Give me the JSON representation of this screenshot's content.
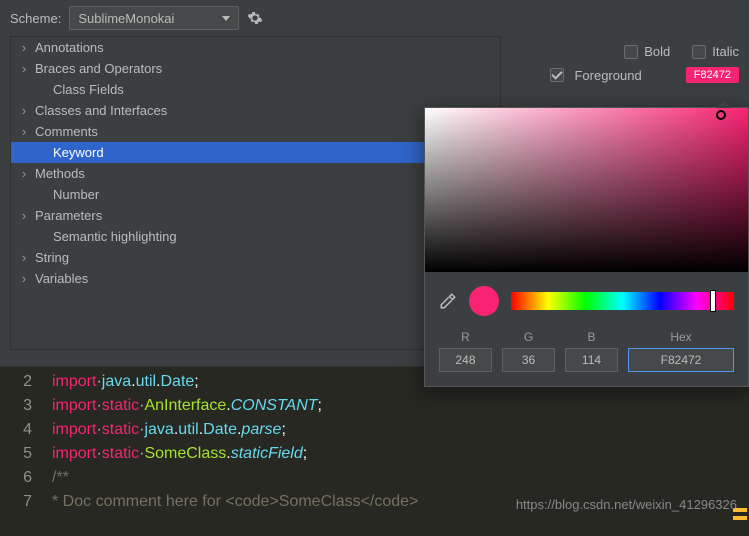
{
  "scheme": {
    "label": "Scheme:",
    "value": "SublimeMonokai"
  },
  "attributes": [
    {
      "label": "Annotations",
      "exp": true
    },
    {
      "label": "Braces and Operators",
      "exp": true
    },
    {
      "label": "Class Fields",
      "exp": false,
      "indent": true
    },
    {
      "label": "Classes and Interfaces",
      "exp": true
    },
    {
      "label": "Comments",
      "exp": true
    },
    {
      "label": "Keyword",
      "exp": false,
      "indent": true,
      "selected": true
    },
    {
      "label": "Methods",
      "exp": true
    },
    {
      "label": "Number",
      "exp": false,
      "indent": true
    },
    {
      "label": "Parameters",
      "exp": true
    },
    {
      "label": "Semantic highlighting",
      "exp": false,
      "indent": true
    },
    {
      "label": "String",
      "exp": true
    },
    {
      "label": "Variables",
      "exp": true
    }
  ],
  "fontOptions": {
    "bold": "Bold",
    "italic": "Italic",
    "foreground": "Foreground"
  },
  "swatch": "F82472",
  "picker": {
    "r": "R",
    "g": "G",
    "b": "B",
    "hex": "Hex",
    "rVal": "248",
    "gVal": "36",
    "bVal": "114",
    "hexVal": "F82472"
  },
  "code": {
    "l2a": "import",
    "l2b": "java",
    "l2c": "util",
    "l2d": "Date",
    "l3a": "import",
    "l3b": "static",
    "l3c": "AnInterface",
    "l3d": "CONSTANT",
    "l4a": "import",
    "l4b": "static",
    "l4c": "java",
    "l4d": "util",
    "l4e": "Date",
    "l4f": "parse",
    "l5a": "import",
    "l5b": "static",
    "l5c": "SomeClass",
    "l5d": "staticField",
    "l6": "/**",
    "l7": " * Doc comment here for <code>SomeClass</code>"
  },
  "watermark": "https://blog.csdn.net/weixin_41296326"
}
